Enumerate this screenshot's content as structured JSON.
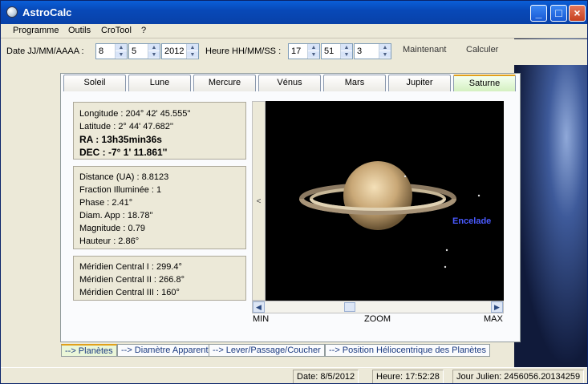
{
  "window": {
    "title": "AstroCalc"
  },
  "menu": {
    "items": [
      "Programme",
      "Outils",
      "CroTool",
      "?"
    ]
  },
  "toolbar": {
    "date_label": "Date JJ/MM/AAAA :",
    "day": "8",
    "month": "5",
    "year": "2012",
    "time_label": "Heure HH/MM/SS :",
    "hour": "17",
    "minute": "51",
    "second": "3",
    "now_label": "Maintenant",
    "calc_label": "Calculer"
  },
  "tabs": [
    "Soleil",
    "Lune",
    "Mercure",
    "Vénus",
    "Mars",
    "Jupiter",
    "Saturne"
  ],
  "coords": {
    "longitude": "Longitude : 204° 42' 45.555''",
    "latitude": "Latitude : 2° 44' 47.682''",
    "ra": "RA : 13h35min36s",
    "dec": "DEC : -7° 1' 11.861''"
  },
  "physical": {
    "distance": "Distance (UA) : 8.8123",
    "fraction": "Fraction Illuminée : 1",
    "phase": "Phase : 2.41°",
    "diam": "Diam. App : 18.78''",
    "magnitude": "Magnitude : 0.79",
    "hauteur": "Hauteur : 2.86°"
  },
  "meridian": {
    "m1": "Méridien Central I : 299.4°",
    "m2": "Méridien Central II : 266.8°",
    "m3": "Méridien Central III : 160°"
  },
  "view": {
    "moon_label": "Encelade",
    "zoom_fraction": 0.37
  },
  "zoom": {
    "min": "MIN",
    "label": "ZOOM",
    "max": "MAX"
  },
  "bottom_tabs": [
    "--> Planètes",
    "--> Diamètre Apparent",
    "--> Lever/Passage/Coucher",
    "--> Position Héliocentrique des Planètes"
  ],
  "status": {
    "date": "Date: 8/5/2012",
    "heure": "Heure: 17:52:28",
    "julien": "Jour Julien: 2456056.20134259"
  }
}
